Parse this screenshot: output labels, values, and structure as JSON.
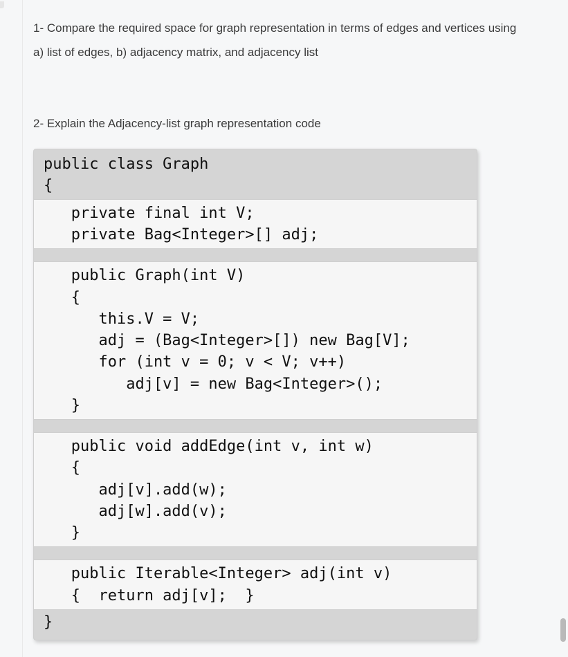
{
  "question1": {
    "line1": "1- Compare the required space for graph representation in terms of edges and vertices using",
    "line2": "a) list of edges, b) adjacency matrix, and adjacency list"
  },
  "question2": {
    "prompt": "2- Explain the Adjacency-list graph representation code"
  },
  "code": {
    "class_decl": "public class Graph",
    "open_brace": "{",
    "field_v": "   private final int V;",
    "field_adj": "   private Bag<Integer>[] adj;",
    "ctor_sig": "   public Graph(int V)",
    "ctor_open": "   {",
    "ctor_l1": "      this.V = V;",
    "ctor_l2": "      adj = (Bag<Integer>[]) new Bag[V];",
    "ctor_l3": "      for (int v = 0; v < V; v++)",
    "ctor_l4": "         adj[v] = new Bag<Integer>();",
    "ctor_close": "   }",
    "addEdge_sig": "   public void addEdge(int v, int w)",
    "addEdge_open": "   {",
    "addEdge_l1": "      adj[v].add(w);",
    "addEdge_l2": "      adj[w].add(v);",
    "addEdge_close": "   }",
    "adj_sig": "   public Iterable<Integer> adj(int v)",
    "adj_body": "   {  return adj[v];  }",
    "close_brace": "}"
  }
}
